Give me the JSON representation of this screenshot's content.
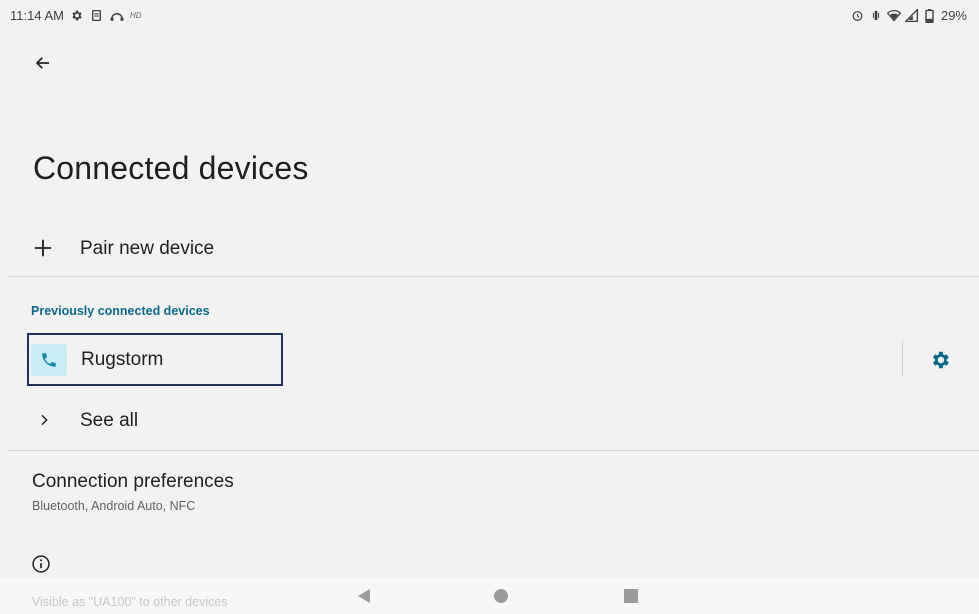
{
  "status_bar": {
    "time": "11:14 AM",
    "left_icons": [
      "settings-gear-icon",
      "clipboard-icon",
      "headset-arc-icon",
      "hd-icon"
    ],
    "hd_label": "HD",
    "right_icons": [
      "alarm-icon",
      "vibrate-icon",
      "wifi-icon",
      "signal-icon",
      "battery-icon"
    ],
    "battery": "29%"
  },
  "header": {
    "title": "Connected devices"
  },
  "pair_new": {
    "label": "Pair new device",
    "icon": "plus-icon"
  },
  "previous": {
    "section_title": "Previously connected devices",
    "devices": [
      {
        "name": "Rugstorm",
        "icon": "phone-icon",
        "settings_icon": "gear-icon"
      }
    ],
    "see_all_label": "See all"
  },
  "preferences": {
    "title": "Connection preferences",
    "subtitle": "Bluetooth, Android Auto, NFC"
  },
  "footer": {
    "info_icon": "info-icon",
    "visible_text": "Visible as \"UA100\" to other devices"
  },
  "colors": {
    "background": "#f2f2f3",
    "accent": "#0b6a8c",
    "device_icon_bg": "#c9edf4",
    "focus_border": "#1f2f55"
  }
}
